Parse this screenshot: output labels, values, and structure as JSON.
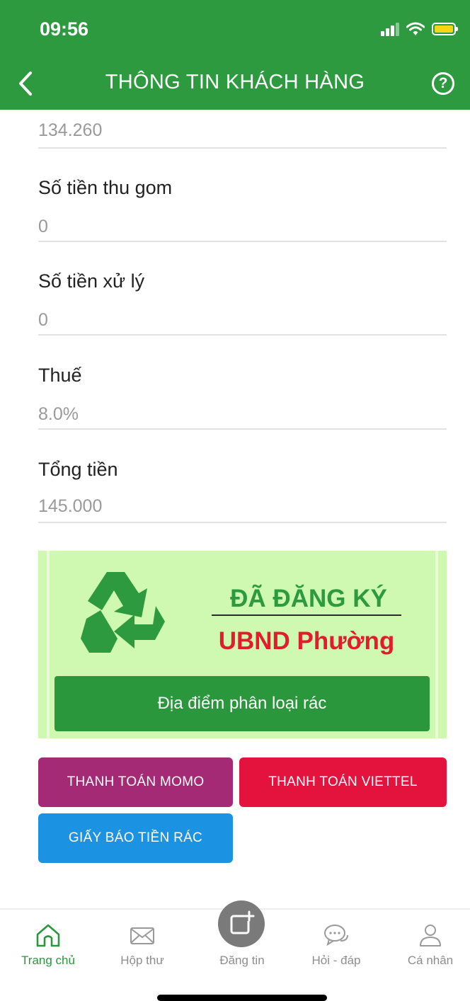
{
  "status_bar": {
    "time": "09:56"
  },
  "header": {
    "title": "THÔNG TIN KHÁCH HÀNG"
  },
  "fields": [
    {
      "label": "",
      "value": "134.260"
    },
    {
      "label": "Số tiền thu gom",
      "value": "0"
    },
    {
      "label": "Số tiền xử lý",
      "value": "0"
    },
    {
      "label": "Thuế",
      "value": "8.0%"
    },
    {
      "label": "Tổng tiền",
      "value": "145.000"
    }
  ],
  "registration": {
    "status": "ĐÃ ĐĂNG KÝ",
    "authority": "UBND Phường",
    "sorting_button": "Địa điểm phân loại rác"
  },
  "payments": {
    "momo": "THANH TOÁN MOMO",
    "viettel": "THANH TOÁN VIETTEL",
    "bill": "GIẤY BÁO TIỀN RÁC"
  },
  "tabbar": {
    "items": [
      {
        "label": "Trang chủ",
        "icon": "home-icon",
        "active": true
      },
      {
        "label": "Hộp thư",
        "icon": "mail-icon",
        "active": false
      },
      {
        "label": "Đăng tin",
        "icon": "post-icon",
        "active": false
      },
      {
        "label": "Hỏi - đáp",
        "icon": "chat-icon",
        "active": false
      },
      {
        "label": "Cá nhân",
        "icon": "user-icon",
        "active": false
      }
    ]
  },
  "colors": {
    "brand_green": "#2e9a3f",
    "card_green": "#cff8b0",
    "momo": "#a52a75",
    "viettel": "#e3133d",
    "bill": "#1b93e2",
    "alert_red": "#e21c2c"
  }
}
